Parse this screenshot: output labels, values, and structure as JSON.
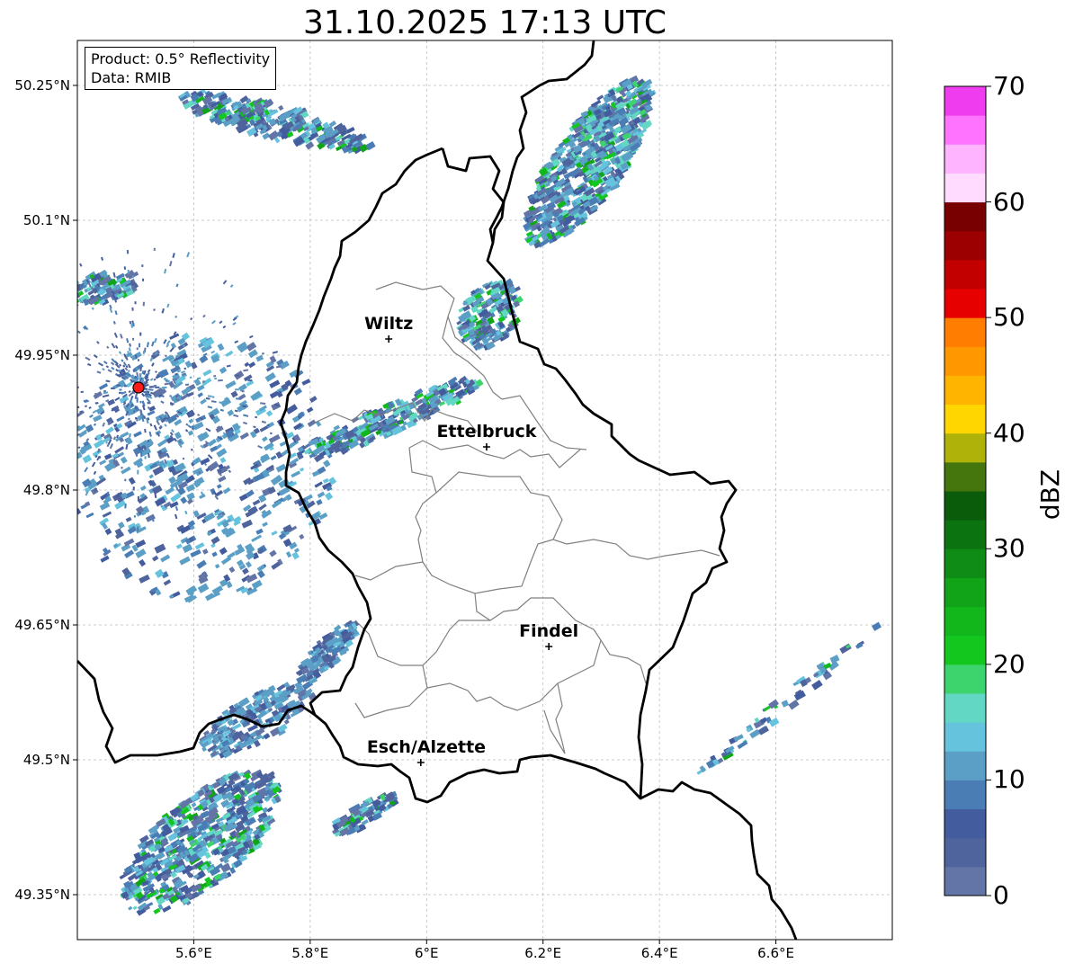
{
  "title": "31.10.2025 17:13 UTC",
  "info": {
    "product": "Product: 0.5° Reflectivity",
    "data": "Data: RMIB"
  },
  "axes": {
    "lon_range": [
      5.4,
      6.8
    ],
    "lat_range": [
      49.3,
      50.3
    ],
    "lat_ticks": [
      {
        "value": 50.25,
        "label": "50.25°N"
      },
      {
        "value": 50.1,
        "label": "50.1°N"
      },
      {
        "value": 49.95,
        "label": "49.95°N"
      },
      {
        "value": 49.8,
        "label": "49.8°N"
      },
      {
        "value": 49.65,
        "label": "49.65°N"
      },
      {
        "value": 49.5,
        "label": "49.5°N"
      },
      {
        "value": 49.35,
        "label": "49.35°N"
      }
    ],
    "lon_ticks": [
      {
        "value": 5.6,
        "label": "5.6°E"
      },
      {
        "value": 5.8,
        "label": "5.8°E"
      },
      {
        "value": 6.0,
        "label": "6°E"
      },
      {
        "value": 6.2,
        "label": "6.2°E"
      },
      {
        "value": 6.4,
        "label": "6.4°E"
      },
      {
        "value": 6.6,
        "label": "6.6°E"
      }
    ]
  },
  "cities": [
    {
      "name": "Wiltz",
      "lon": 5.935,
      "lat": 49.968
    },
    {
      "name": "Ettelbruck",
      "lon": 6.103,
      "lat": 49.848
    },
    {
      "name": "Findel",
      "lon": 6.21,
      "lat": 49.626
    },
    {
      "name": "Esch/Alzette",
      "lon": 5.99,
      "lat": 49.497
    }
  ],
  "radar_site": {
    "lon": 5.505,
    "lat": 49.914,
    "color": "#ff1a1a"
  },
  "colorbar": {
    "label": "dBZ",
    "min": 0,
    "max": 70,
    "step": 2.5,
    "ticks": [
      "0",
      "10",
      "20",
      "30",
      "40",
      "50",
      "60",
      "70"
    ],
    "colors": [
      "#6374a6",
      "#4f639c",
      "#425c9d",
      "#4b7db5",
      "#5c9fc6",
      "#66c3dd",
      "#62d7c4",
      "#3ed46d",
      "#14c71f",
      "#12b81b",
      "#11a419",
      "#0f8c15",
      "#0b7410",
      "#0a5c0b",
      "#45760e",
      "#afb309",
      "#ffd600",
      "#ffb400",
      "#ff9800",
      "#ff7d00",
      "#e60000",
      "#c30000",
      "#9c0000",
      "#780000",
      "#ffdcff",
      "#ffb4ff",
      "#ff73ff",
      "#ee3cee"
    ]
  },
  "map_colors": {
    "country_border": "#000000",
    "canton_border": "#808080",
    "grid": "#bcbcbc"
  }
}
